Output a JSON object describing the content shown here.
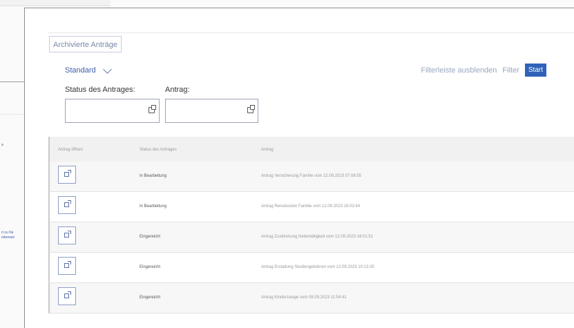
{
  "background": {
    "fragments": [
      "a",
      "rt zu Ne",
      "mbenutz"
    ]
  },
  "tab": {
    "label": "Archivierte Anträge"
  },
  "variant": {
    "label": "Standard"
  },
  "filterbar": {
    "hide_label": "Filterleiste ausblenden",
    "filter_label": "Filter",
    "start_label": "Start",
    "fields": [
      {
        "label": "Status des Antrages:",
        "value": ""
      },
      {
        "label": "Antrag:",
        "value": ""
      }
    ]
  },
  "table": {
    "columns": [
      "Antrag öffnen",
      "Status des Antrages",
      "Antrag"
    ],
    "rows": [
      {
        "status": "In Bearbeitung",
        "antrag": "Antrag Versicherung Familie vom 22.09.2023 07:08:55"
      },
      {
        "status": "In Bearbeitung",
        "antrag": "Antrag Reisekosten Familie vom 12.09.2023 16:03:44"
      },
      {
        "status": "Eingereicht",
        "antrag": "Antrag Zustimmung Nebentätigkeit vom 12.09.2023 16:01:51"
      },
      {
        "status": "Eingereicht",
        "antrag": "Antrag Erstattung Studiengebühren vom 12.09.2023 10:13:35"
      },
      {
        "status": "Eingereicht",
        "antrag": "Antrag Kinderzulage vom 08.09.2023 11:54:41"
      }
    ]
  },
  "colors": {
    "accent": "#2f62b8",
    "link": "#3b5ba7"
  }
}
